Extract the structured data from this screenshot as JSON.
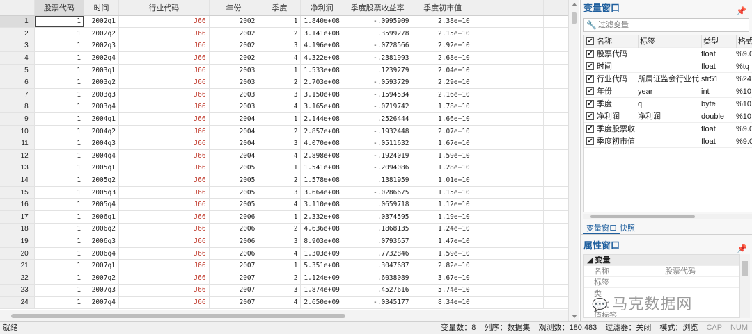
{
  "grid": {
    "columns": [
      "股票代码",
      "时间",
      "行业代码",
      "年份",
      "季度",
      "净利润",
      "季度股票收益率",
      "季度初市值"
    ],
    "rows": [
      {
        "n": "1",
        "code": "1",
        "time": "2002q1",
        "ind": "J66",
        "year": "2002",
        "q": "1",
        "np": "1.840e+08",
        "ret": "-.0995909",
        "mv": "2.38e+10"
      },
      {
        "n": "2",
        "code": "1",
        "time": "2002q2",
        "ind": "J66",
        "year": "2002",
        "q": "2",
        "np": "3.141e+08",
        "ret": ".3599278",
        "mv": "2.15e+10"
      },
      {
        "n": "3",
        "code": "1",
        "time": "2002q3",
        "ind": "J66",
        "year": "2002",
        "q": "3",
        "np": "4.196e+08",
        "ret": "-.0728566",
        "mv": "2.92e+10"
      },
      {
        "n": "4",
        "code": "1",
        "time": "2002q4",
        "ind": "J66",
        "year": "2002",
        "q": "4",
        "np": "4.322e+08",
        "ret": "-.2381993",
        "mv": "2.68e+10"
      },
      {
        "n": "5",
        "code": "1",
        "time": "2003q1",
        "ind": "J66",
        "year": "2003",
        "q": "1",
        "np": "1.533e+08",
        "ret": ".1239279",
        "mv": "2.04e+10"
      },
      {
        "n": "6",
        "code": "1",
        "time": "2003q2",
        "ind": "J66",
        "year": "2003",
        "q": "2",
        "np": "2.703e+08",
        "ret": "-.0593729",
        "mv": "2.29e+10"
      },
      {
        "n": "7",
        "code": "1",
        "time": "2003q3",
        "ind": "J66",
        "year": "2003",
        "q": "3",
        "np": "3.150e+08",
        "ret": "-.1594534",
        "mv": "2.16e+10"
      },
      {
        "n": "8",
        "code": "1",
        "time": "2003q4",
        "ind": "J66",
        "year": "2003",
        "q": "4",
        "np": "3.165e+08",
        "ret": "-.0719742",
        "mv": "1.78e+10"
      },
      {
        "n": "9",
        "code": "1",
        "time": "2004q1",
        "ind": "J66",
        "year": "2004",
        "q": "1",
        "np": "2.144e+08",
        "ret": ".2526444",
        "mv": "1.66e+10"
      },
      {
        "n": "10",
        "code": "1",
        "time": "2004q2",
        "ind": "J66",
        "year": "2004",
        "q": "2",
        "np": "2.857e+08",
        "ret": "-.1932448",
        "mv": "2.07e+10"
      },
      {
        "n": "11",
        "code": "1",
        "time": "2004q3",
        "ind": "J66",
        "year": "2004",
        "q": "3",
        "np": "4.070e+08",
        "ret": "-.0511632",
        "mv": "1.67e+10"
      },
      {
        "n": "12",
        "code": "1",
        "time": "2004q4",
        "ind": "J66",
        "year": "2004",
        "q": "4",
        "np": "2.898e+08",
        "ret": "-.1924019",
        "mv": "1.59e+10"
      },
      {
        "n": "13",
        "code": "1",
        "time": "2005q1",
        "ind": "J66",
        "year": "2005",
        "q": "1",
        "np": "1.541e+08",
        "ret": "-.2094086",
        "mv": "1.28e+10"
      },
      {
        "n": "14",
        "code": "1",
        "time": "2005q2",
        "ind": "J66",
        "year": "2005",
        "q": "2",
        "np": "1.578e+08",
        "ret": ".1381959",
        "mv": "1.01e+10"
      },
      {
        "n": "15",
        "code": "1",
        "time": "2005q3",
        "ind": "J66",
        "year": "2005",
        "q": "3",
        "np": "3.664e+08",
        "ret": "-.0286675",
        "mv": "1.15e+10"
      },
      {
        "n": "16",
        "code": "1",
        "time": "2005q4",
        "ind": "J66",
        "year": "2005",
        "q": "4",
        "np": "3.110e+08",
        "ret": ".0659718",
        "mv": "1.12e+10"
      },
      {
        "n": "17",
        "code": "1",
        "time": "2006q1",
        "ind": "J66",
        "year": "2006",
        "q": "1",
        "np": "2.332e+08",
        "ret": ".0374595",
        "mv": "1.19e+10"
      },
      {
        "n": "18",
        "code": "1",
        "time": "2006q2",
        "ind": "J66",
        "year": "2006",
        "q": "2",
        "np": "4.636e+08",
        "ret": ".1868135",
        "mv": "1.24e+10"
      },
      {
        "n": "19",
        "code": "1",
        "time": "2006q3",
        "ind": "J66",
        "year": "2006",
        "q": "3",
        "np": "8.903e+08",
        "ret": ".0793657",
        "mv": "1.47e+10"
      },
      {
        "n": "20",
        "code": "1",
        "time": "2006q4",
        "ind": "J66",
        "year": "2006",
        "q": "4",
        "np": "1.303e+09",
        "ret": ".7732846",
        "mv": "1.59e+10"
      },
      {
        "n": "21",
        "code": "1",
        "time": "2007q1",
        "ind": "J66",
        "year": "2007",
        "q": "1",
        "np": "5.351e+08",
        "ret": ".3047687",
        "mv": "2.82e+10"
      },
      {
        "n": "22",
        "code": "1",
        "time": "2007q2",
        "ind": "J66",
        "year": "2007",
        "q": "2",
        "np": "1.124e+09",
        "ret": ".6038089",
        "mv": "3.67e+10"
      },
      {
        "n": "23",
        "code": "1",
        "time": "2007q3",
        "ind": "J66",
        "year": "2007",
        "q": "3",
        "np": "1.874e+09",
        "ret": ".4527616",
        "mv": "5.74e+10"
      },
      {
        "n": "24",
        "code": "1",
        "time": "2007q4",
        "ind": "J66",
        "year": "2007",
        "q": "4",
        "np": "2.650e+09",
        "ret": "-.0345177",
        "mv": "8.34e+10"
      }
    ]
  },
  "variables": {
    "title": "变量窗口",
    "filter_placeholder": "过滤变量",
    "headers": {
      "name": "名称",
      "label": "标签",
      "type": "类型",
      "format": "格式"
    },
    "items": [
      {
        "name": "股票代码",
        "label": "",
        "type": "float",
        "format": "%9.0"
      },
      {
        "name": "时间",
        "label": "",
        "type": "float",
        "format": "%tq"
      },
      {
        "name": "行业代码",
        "label": "所属证监会行业代...",
        "type": "str51",
        "format": "%24"
      },
      {
        "name": "年份",
        "label": "year",
        "type": "int",
        "format": "%10"
      },
      {
        "name": "季度",
        "label": "q",
        "type": "byte",
        "format": "%10"
      },
      {
        "name": "净利润",
        "label": "净利润",
        "type": "double",
        "format": "%10"
      },
      {
        "name": "季度股票收...",
        "label": "",
        "type": "float",
        "format": "%9.0"
      },
      {
        "name": "季度初市值",
        "label": "",
        "type": "float",
        "format": "%9.0"
      }
    ]
  },
  "panel_tabs": {
    "variables": "变量窗口",
    "snapshots": "快照"
  },
  "properties": {
    "title": "属性窗口",
    "group": "变量",
    "rows": [
      {
        "key": "名称",
        "value": "股票代码"
      },
      {
        "key": "标签",
        "value": ""
      },
      {
        "key": "类",
        "value": ""
      },
      {
        "key": "格式",
        "value": ""
      },
      {
        "key": "值标签",
        "value": ""
      }
    ]
  },
  "watermark": "马克数据网",
  "status": {
    "ready": "就绪",
    "var_count": "变量数：8",
    "sort": "列序：数据集",
    "obs": "观测数：180,483",
    "filter": "过滤器：关闭",
    "mode": "模式：浏览",
    "cap": "CAP",
    "num": "NUM"
  },
  "colors": {
    "string_value": "#c0392b",
    "panel_title": "#1f5f9e"
  }
}
